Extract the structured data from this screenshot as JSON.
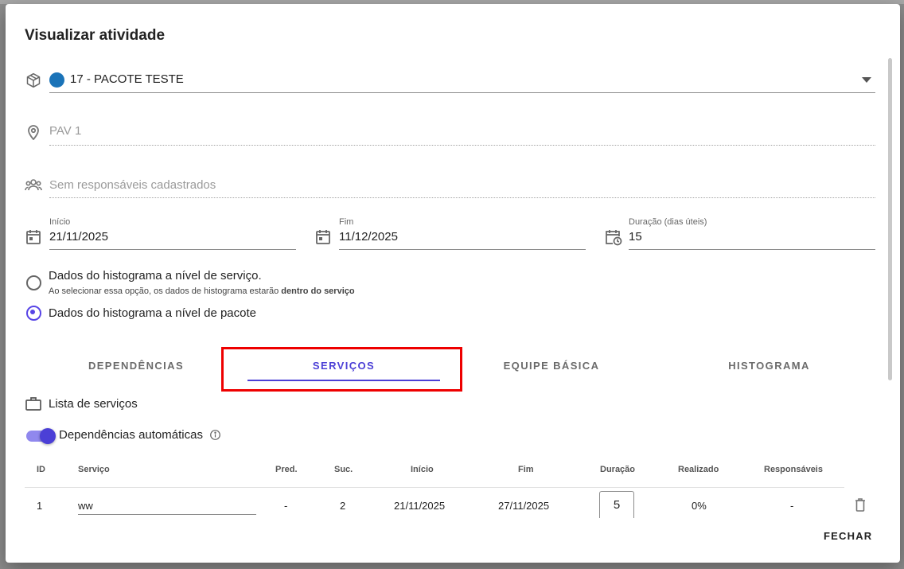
{
  "dialog": {
    "title": "Visualizar atividade",
    "package": {
      "value": "17 - PACOTE TESTE",
      "dot_color": "#1a73b8"
    },
    "location": {
      "placeholder": "PAV 1"
    },
    "responsibles": {
      "placeholder": "Sem responsáveis cadastrados"
    },
    "start": {
      "label": "Início",
      "value": "21/11/2025"
    },
    "end": {
      "label": "Fim",
      "value": "11/12/2025"
    },
    "duration": {
      "label": "Duração (dias úteis)",
      "value": "15"
    },
    "radio_service": {
      "label": "Dados do histograma a nível de serviço.",
      "hint_prefix": "Ao selecionar essa opção, os dados de histograma estarão ",
      "hint_bold": "dentro do serviço",
      "checked": false
    },
    "radio_package": {
      "label": "Dados do histograma a nível de pacote",
      "checked": true
    },
    "tabs": [
      "DEPENDÊNCIAS",
      "SERVIÇOS",
      "EQUIPE BÁSICA",
      "HISTOGRAMA"
    ],
    "active_tab": "SERVIÇOS",
    "services_title": "Lista de serviços",
    "auto_deps": {
      "label": "Dependências automáticas",
      "enabled": true
    },
    "table": {
      "headers": [
        "ID",
        "Serviço",
        "Pred.",
        "Suc.",
        "Início",
        "Fim",
        "Duração",
        "Realizado",
        "Responsáveis"
      ],
      "rows": [
        {
          "id": "1",
          "service": "ww",
          "pred": "-",
          "suc": "2",
          "start": "21/11/2025",
          "end": "27/11/2025",
          "duration": "5",
          "done": "0%",
          "responsible": "-"
        }
      ]
    },
    "close_label": "FECHAR"
  },
  "colors": {
    "accent": "#4b3fd6",
    "highlight": "#e00000"
  }
}
